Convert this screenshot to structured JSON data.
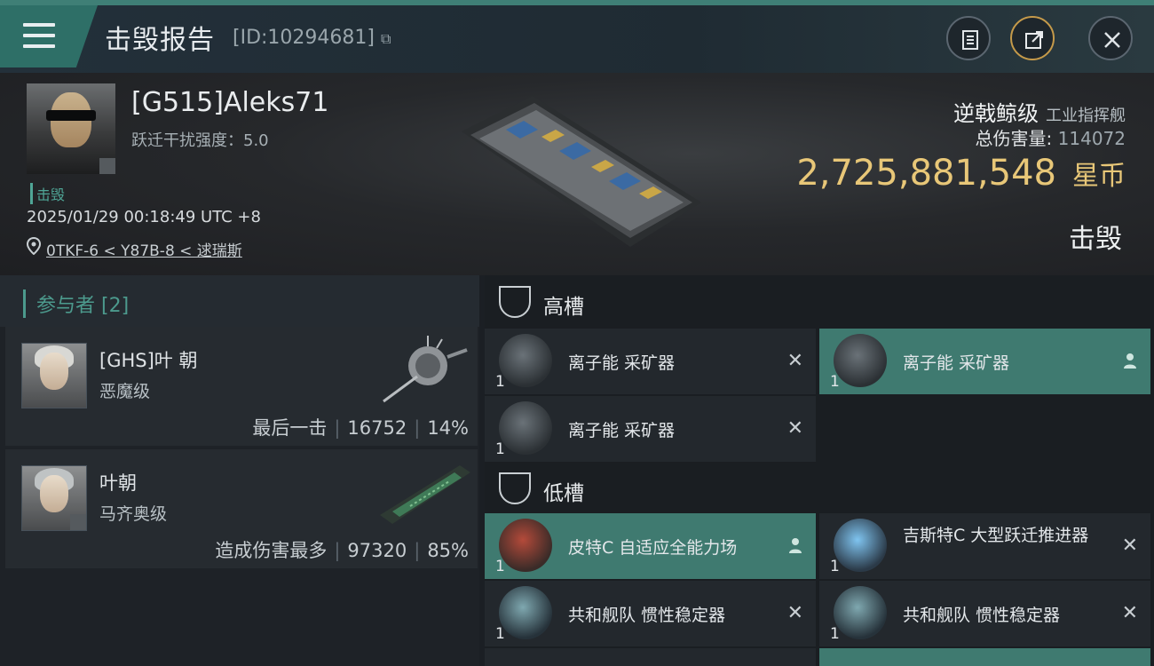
{
  "header": {
    "title": "击毁报告",
    "report_id": "[ID:10294681]"
  },
  "victim": {
    "name": "[G515]Aleks71",
    "warp_disruption": "跃迁干扰强度：5.0",
    "tag": "击毁",
    "timestamp": "2025/01/29 00:18:49 UTC +8",
    "location": "0TKF-6 < Y87B-8 < 逑瑞斯",
    "ship_class": "逆戟鲸级",
    "ship_type": "工业指挥舰",
    "damage_label": "总伤害量:",
    "damage_value": "114072",
    "isk_value": "2,725,881,548",
    "isk_unit": "星币",
    "status": "击毁"
  },
  "participants": {
    "title": "参与者 [2]",
    "rows": [
      {
        "name": "[GHS]叶 朝",
        "ship": "恶魔级",
        "role": "最后一击",
        "damage": "16752",
        "percent": "14%"
      },
      {
        "name": "叶朝",
        "ship": "马齐奥级",
        "role": "造成伤害最多",
        "damage": "97320",
        "percent": "85%"
      }
    ]
  },
  "slots": {
    "high_label": "高槽",
    "low_label": "低槽",
    "high": [
      {
        "qty": "1",
        "name": "离子能 采矿器",
        "mark": "✕"
      },
      {
        "qty": "1",
        "name": "离子能 采矿器",
        "mark": "person"
      },
      {
        "qty": "1",
        "name": "离子能 采矿器",
        "mark": "✕"
      }
    ],
    "low": [
      {
        "qty": "1",
        "name": "皮特C 自适应全能力场",
        "mark": "person"
      },
      {
        "qty": "1",
        "name": "吉斯特C 大型跃迁推进器",
        "mark": "✕"
      },
      {
        "qty": "1",
        "name": "共和舰队 惯性稳定器",
        "mark": "✕"
      },
      {
        "qty": "1",
        "name": "共和舰队 惯性稳定器",
        "mark": "✕"
      }
    ]
  },
  "colors": {
    "accent": "#3f7a70",
    "isk": "#e8c778"
  }
}
